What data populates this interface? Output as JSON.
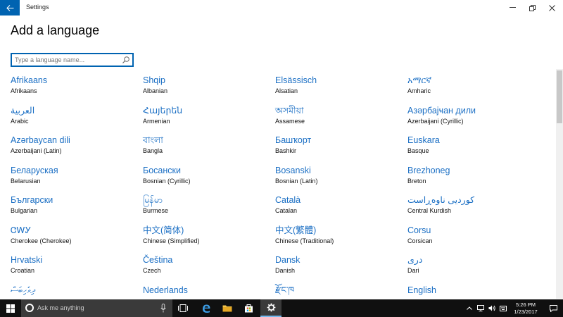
{
  "window": {
    "title": "Settings",
    "back_icon": "arrow-left-icon"
  },
  "page": {
    "title": "Add a language"
  },
  "search": {
    "placeholder": "Type a language name..."
  },
  "languages": [
    {
      "native": "Afrikaans",
      "english": "Afrikaans"
    },
    {
      "native": "Shqip",
      "english": "Albanian"
    },
    {
      "native": "Elsässisch",
      "english": "Alsatian"
    },
    {
      "native": "አማርኛ",
      "english": "Amharic"
    },
    {
      "native": "العربية",
      "english": "Arabic"
    },
    {
      "native": "Հայերեն",
      "english": "Armenian"
    },
    {
      "native": "অসমীয়া",
      "english": "Assamese"
    },
    {
      "native": "Азәрбајҹан дили",
      "english": "Azerbaijani (Cyrillic)"
    },
    {
      "native": "Azərbaycan dili",
      "english": "Azerbaijani (Latin)"
    },
    {
      "native": "বাংলা",
      "english": "Bangla"
    },
    {
      "native": "Башҡорт",
      "english": "Bashkir"
    },
    {
      "native": "Euskara",
      "english": "Basque"
    },
    {
      "native": "Беларуская",
      "english": "Belarusian"
    },
    {
      "native": "Босански",
      "english": "Bosnian (Cyrillic)"
    },
    {
      "native": "Bosanski",
      "english": "Bosnian (Latin)"
    },
    {
      "native": "Brezhoneg",
      "english": "Breton"
    },
    {
      "native": "Български",
      "english": "Bulgarian"
    },
    {
      "native": "မြန်မာ",
      "english": "Burmese"
    },
    {
      "native": "Català",
      "english": "Catalan"
    },
    {
      "native": "کوردیی ناوەڕاست",
      "english": "Central Kurdish"
    },
    {
      "native": "ᏣᎳᎩ",
      "english": "Cherokee (Cherokee)"
    },
    {
      "native": "中文(简体)",
      "english": "Chinese (Simplified)"
    },
    {
      "native": "中文(繁體)",
      "english": "Chinese (Traditional)"
    },
    {
      "native": "Corsu",
      "english": "Corsican"
    },
    {
      "native": "Hrvatski",
      "english": "Croatian"
    },
    {
      "native": "Čeština",
      "english": "Czech"
    },
    {
      "native": "Dansk",
      "english": "Danish"
    },
    {
      "native": "دری",
      "english": "Dari"
    },
    {
      "native": "ދިވެހިބަސް",
      "english": ""
    },
    {
      "native": "Nederlands",
      "english": ""
    },
    {
      "native": "རྫོང་ཁ",
      "english": ""
    },
    {
      "native": "English",
      "english": ""
    }
  ],
  "taskbar": {
    "search_placeholder": "Ask me anything",
    "time": "5:26 PM",
    "date": "1/23/2017"
  }
}
